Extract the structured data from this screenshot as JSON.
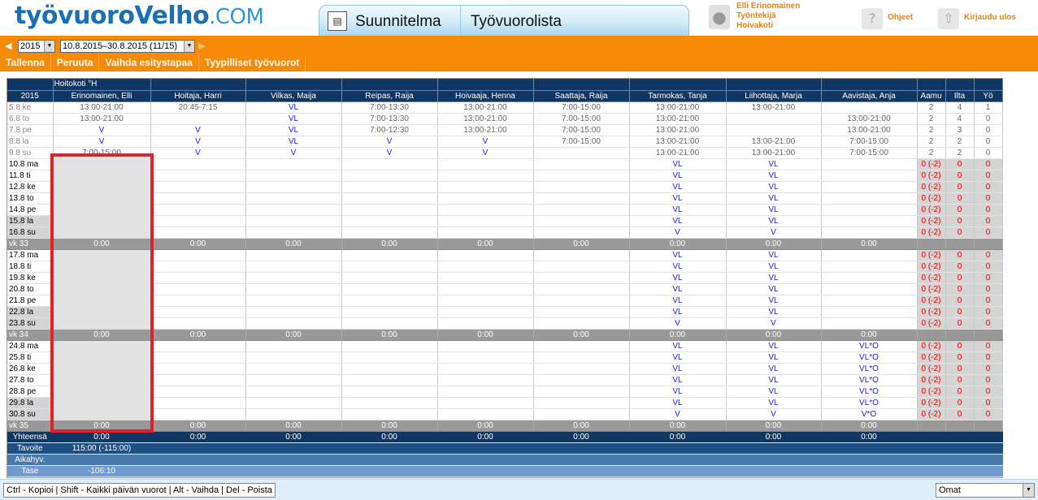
{
  "header": {
    "logo_main": "työvuoroVelho",
    "logo_suffix": ".COM",
    "tabs": [
      "Suunnitelma",
      "Työvuorolista"
    ],
    "user_name": "Elli Erinomainen",
    "user_role": "Työntekijä",
    "user_unit": "Hoivakoti",
    "help_label": "Ohjeet",
    "logout_label": "Kirjaudu ulos"
  },
  "selectors": {
    "year": "2015",
    "period": "10.8.2015–30.8.2015 (11/15)"
  },
  "toolbar": [
    "Tallenna",
    "Peruuta",
    "Vaihda esitystapaa",
    "Tyypilliset työvuorot"
  ],
  "grid": {
    "unit_title": "Hoitokoti °H",
    "year_label": "2015",
    "employees": [
      "Erinomainen, Elli",
      "Hoitaja, Harri",
      "Vilkas, Maija",
      "Reipas, Raija",
      "Hoivaaja, Henna",
      "Saattaja, Raija",
      "Tarmokas, Tanja",
      "Liihottaja, Marja",
      "Aavistaja, Anja"
    ],
    "count_headers": [
      "Aamu",
      "Ilta",
      "Yö"
    ],
    "rows": [
      {
        "date": "5.8 ke",
        "type": "past",
        "cells": [
          "13:00-21:00",
          "20:45-7:15",
          "VL",
          "7:00-13:30",
          "13:00-21:00",
          "7:00-15:00",
          "13:00-21:00",
          "13:00-21:00",
          ""
        ],
        "counts": [
          "2",
          "4",
          "1"
        ]
      },
      {
        "date": "6.8 to",
        "type": "past",
        "cells": [
          "13:00-21:00",
          "",
          "VL",
          "7:00-13:30",
          "13:00-21:00",
          "7:00-15:00",
          "13:00-21:00",
          "",
          "13:00-21:00"
        ],
        "counts": [
          "2",
          "4",
          "0"
        ]
      },
      {
        "date": "7.8 pe",
        "type": "past",
        "cells": [
          "V",
          "V",
          "VL",
          "7:00-12:30",
          "13:00-21:00",
          "7:00-15:00",
          "13:00-21:00",
          "",
          "13:00-21:00"
        ],
        "counts": [
          "2",
          "3",
          "0"
        ]
      },
      {
        "date": "8.8 la",
        "type": "past",
        "cells": [
          "V",
          "V",
          "VL",
          "V",
          "V",
          "7:00-15:00",
          "13:00-21:00",
          "13:00-21:00",
          "7:00-15:00"
        ],
        "counts": [
          "2",
          "2",
          "0"
        ]
      },
      {
        "date": "9.8 su",
        "type": "past",
        "cells": [
          "7:00-15:00",
          "V",
          "V",
          "V",
          "V",
          "",
          "13:00-21:00",
          "13:00-21:00",
          "7:00-15:00"
        ],
        "counts": [
          "2",
          "2",
          "0"
        ]
      },
      {
        "date": "10.8 ma",
        "type": "day",
        "cells": [
          "",
          "",
          "",
          "",
          "",
          "",
          "VL",
          "VL",
          ""
        ],
        "counts": [
          "0 (-2)",
          "0",
          "0"
        ]
      },
      {
        "date": "11.8 ti",
        "type": "day",
        "cells": [
          "",
          "",
          "",
          "",
          "",
          "",
          "VL",
          "VL",
          ""
        ],
        "counts": [
          "0 (-2)",
          "0",
          "0"
        ]
      },
      {
        "date": "12.8 ke",
        "type": "day",
        "cells": [
          "",
          "",
          "",
          "",
          "",
          "",
          "VL",
          "VL",
          ""
        ],
        "counts": [
          "0 (-2)",
          "0",
          "0"
        ]
      },
      {
        "date": "13.8 to",
        "type": "day",
        "cells": [
          "",
          "",
          "",
          "",
          "",
          "",
          "VL",
          "VL",
          ""
        ],
        "counts": [
          "0 (-2)",
          "0",
          "0"
        ]
      },
      {
        "date": "14.8 pe",
        "type": "day",
        "cells": [
          "",
          "",
          "",
          "",
          "",
          "",
          "VL",
          "VL",
          ""
        ],
        "counts": [
          "0 (-2)",
          "0",
          "0"
        ]
      },
      {
        "date": "15.8 la",
        "type": "weekend",
        "cells": [
          "",
          "",
          "",
          "",
          "",
          "",
          "VL",
          "VL",
          ""
        ],
        "counts": [
          "0 (-2)",
          "0",
          "0"
        ]
      },
      {
        "date": "16.8 su",
        "type": "weekend",
        "cells": [
          "",
          "",
          "",
          "",
          "",
          "",
          "V",
          "V",
          ""
        ],
        "counts": [
          "0 (-2)",
          "0",
          "0"
        ]
      },
      {
        "date": "vk 33",
        "type": "week",
        "cells": [
          "0:00",
          "0:00",
          "0:00",
          "0:00",
          "0:00",
          "0:00",
          "0:00",
          "0:00",
          "0:00"
        ],
        "counts": [
          "",
          "",
          ""
        ]
      },
      {
        "date": "17.8 ma",
        "type": "day",
        "cells": [
          "",
          "",
          "",
          "",
          "",
          "",
          "VL",
          "VL",
          ""
        ],
        "counts": [
          "0 (-2)",
          "0",
          "0"
        ]
      },
      {
        "date": "18.8 ti",
        "type": "day",
        "cells": [
          "",
          "",
          "",
          "",
          "",
          "",
          "VL",
          "VL",
          ""
        ],
        "counts": [
          "0 (-2)",
          "0",
          "0"
        ]
      },
      {
        "date": "19.8 ke",
        "type": "day",
        "cells": [
          "",
          "",
          "",
          "",
          "",
          "",
          "VL",
          "VL",
          ""
        ],
        "counts": [
          "0 (-2)",
          "0",
          "0"
        ]
      },
      {
        "date": "20.8 to",
        "type": "day",
        "cells": [
          "",
          "",
          "",
          "",
          "",
          "",
          "VL",
          "VL",
          ""
        ],
        "counts": [
          "0 (-2)",
          "0",
          "0"
        ]
      },
      {
        "date": "21.8 pe",
        "type": "day",
        "cells": [
          "",
          "",
          "",
          "",
          "",
          "",
          "VL",
          "VL",
          ""
        ],
        "counts": [
          "0 (-2)",
          "0",
          "0"
        ]
      },
      {
        "date": "22.8 la",
        "type": "weekend",
        "cells": [
          "",
          "",
          "",
          "",
          "",
          "",
          "VL",
          "VL",
          ""
        ],
        "counts": [
          "0 (-2)",
          "0",
          "0"
        ]
      },
      {
        "date": "23.8 su",
        "type": "weekend",
        "cells": [
          "",
          "",
          "",
          "",
          "",
          "",
          "V",
          "V",
          ""
        ],
        "counts": [
          "0 (-2)",
          "0",
          "0"
        ]
      },
      {
        "date": "vk 34",
        "type": "week",
        "cells": [
          "0:00",
          "0:00",
          "0:00",
          "0:00",
          "0:00",
          "0:00",
          "0:00",
          "0:00",
          "0:00"
        ],
        "counts": [
          "",
          "",
          ""
        ]
      },
      {
        "date": "24.8 ma",
        "type": "day",
        "cells": [
          "",
          "",
          "",
          "",
          "",
          "",
          "VL",
          "VL",
          "VL*O"
        ],
        "counts": [
          "0 (-2)",
          "0",
          "0"
        ]
      },
      {
        "date": "25.8 ti",
        "type": "day",
        "cells": [
          "",
          "",
          "",
          "",
          "",
          "",
          "VL",
          "VL",
          "VL*O"
        ],
        "counts": [
          "0 (-2)",
          "0",
          "0"
        ]
      },
      {
        "date": "26.8 ke",
        "type": "day",
        "cells": [
          "",
          "",
          "",
          "",
          "",
          "",
          "VL",
          "VL",
          "VL*O"
        ],
        "counts": [
          "0 (-2)",
          "0",
          "0"
        ]
      },
      {
        "date": "27.8 to",
        "type": "day",
        "cells": [
          "",
          "",
          "",
          "",
          "",
          "",
          "VL",
          "VL",
          "VL*O"
        ],
        "counts": [
          "0 (-2)",
          "0",
          "0"
        ]
      },
      {
        "date": "28.8 pe",
        "type": "day",
        "cells": [
          "",
          "",
          "",
          "",
          "",
          "",
          "VL",
          "VL",
          "VL*O"
        ],
        "counts": [
          "0 (-2)",
          "0",
          "0"
        ]
      },
      {
        "date": "29.8 la",
        "type": "weekend",
        "cells": [
          "",
          "",
          "",
          "",
          "",
          "",
          "VL",
          "VL",
          "VL*O"
        ],
        "counts": [
          "0 (-2)",
          "0",
          "0"
        ]
      },
      {
        "date": "30.8 su",
        "type": "weekend",
        "cells": [
          "",
          "",
          "",
          "",
          "",
          "",
          "V",
          "V",
          "V*O"
        ],
        "counts": [
          "0 (-2)",
          "0",
          "0"
        ]
      },
      {
        "date": "vk 35",
        "type": "week",
        "cells": [
          "0:00",
          "0:00",
          "0:00",
          "0:00",
          "0:00",
          "0:00",
          "0:00",
          "0:00",
          "0:00"
        ],
        "counts": [
          "",
          "",
          ""
        ]
      }
    ],
    "summary": [
      {
        "label": "Yhteensä",
        "cells": [
          "0:00",
          "0:00",
          "0:00",
          "0:00",
          "0:00",
          "0:00",
          "0:00",
          "0:00",
          "0:00"
        ]
      },
      {
        "label": "Tavoite",
        "cells": [
          "115:00 (-115:00)",
          "",
          "",
          "",
          "",
          "",
          "",
          "",
          ""
        ]
      },
      {
        "label": "Aikahyv.",
        "cells": [
          "",
          "",
          "",
          "",
          "",
          "",
          "",
          "",
          ""
        ]
      },
      {
        "label": "Tase",
        "cells": [
          "-106:10",
          "",
          "",
          "",
          "",
          "",
          "",
          "",
          ""
        ]
      }
    ]
  },
  "statusbar": {
    "shortcuts": "Ctrl - Kopioi | Shift - Kaikki päivän vuorot | Alt - Vaihda | Del - Poista",
    "view_select": "Omat"
  },
  "colors": {
    "orange": "#f58a07",
    "navy": "#103763",
    "highlight_red": "#e0202b"
  }
}
